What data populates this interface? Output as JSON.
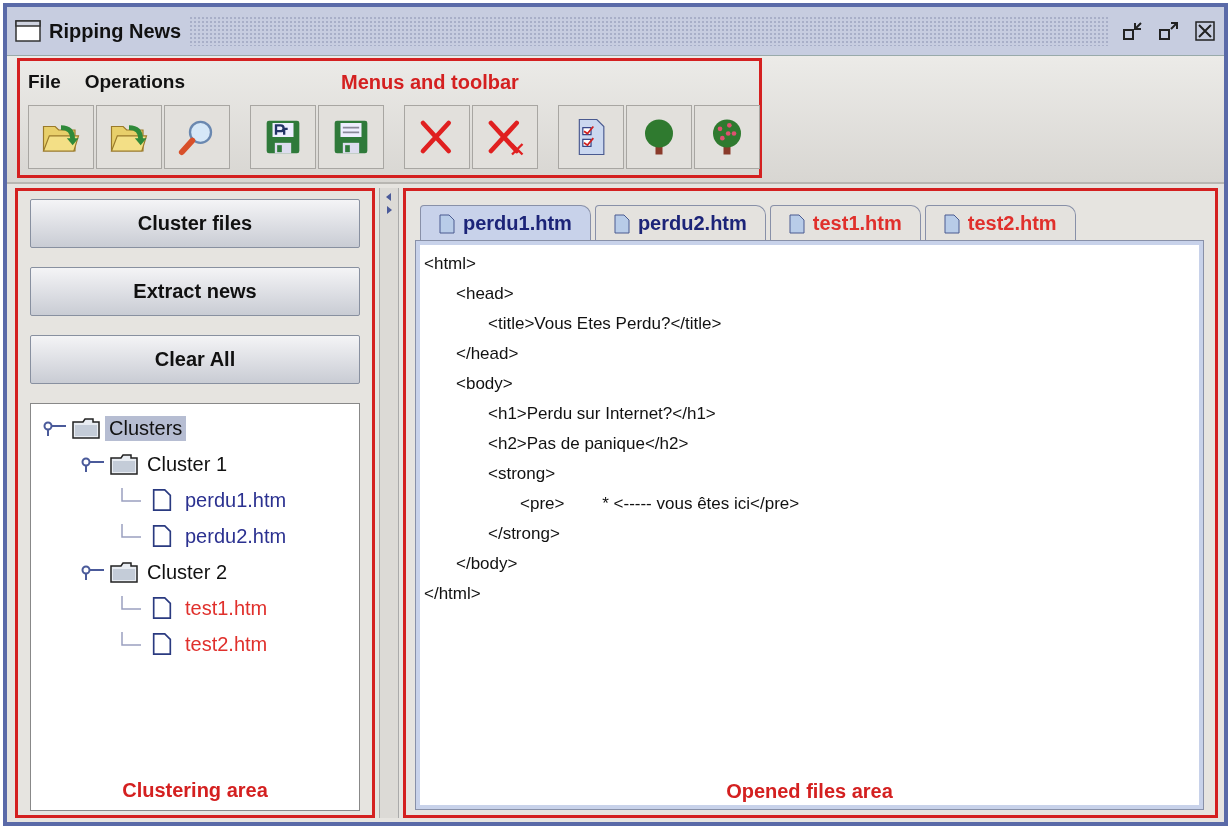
{
  "window": {
    "title": "Ripping News"
  },
  "menus": [
    {
      "label": "File"
    },
    {
      "label": "Operations"
    }
  ],
  "toolbar": {
    "groups": [
      [
        {
          "kind": "open-pr"
        },
        {
          "kind": "open"
        },
        {
          "kind": "search"
        }
      ],
      [
        {
          "kind": "save-pr"
        },
        {
          "kind": "save"
        }
      ],
      [
        {
          "kind": "delete"
        },
        {
          "kind": "delete-all"
        }
      ],
      [
        {
          "kind": "checklist"
        },
        {
          "kind": "tree"
        },
        {
          "kind": "fruit-tree"
        }
      ]
    ]
  },
  "annotations": {
    "toolbar": "Menus and toolbar",
    "left": "Clustering area",
    "right": "Opened files area"
  },
  "buttons": [
    {
      "label": "Cluster files"
    },
    {
      "label": "Extract news"
    },
    {
      "label": "Clear All"
    }
  ],
  "tree": [
    {
      "label": "Clusters",
      "selected": true,
      "expanded": true,
      "children": [
        {
          "label": "Cluster 1",
          "selected": false,
          "expanded": true,
          "children": [
            {
              "label": "perdu1.htm",
              "selected": false,
              "color": "#2b3190"
            },
            {
              "label": "perdu2.htm",
              "selected": false,
              "color": "#2b3190"
            }
          ]
        },
        {
          "label": "Cluster 2",
          "selected": false,
          "expanded": true,
          "children": [
            {
              "label": "test1.htm",
              "selected": false,
              "color": "#e0302c"
            },
            {
              "label": "test2.htm",
              "selected": false,
              "color": "#e0302c"
            }
          ]
        }
      ]
    }
  ],
  "tabs": [
    {
      "label": "perdu1.htm",
      "selected": true,
      "color": "#1c2478"
    },
    {
      "label": "perdu2.htm",
      "selected": false,
      "color": "#1c2478"
    },
    {
      "label": "test1.htm",
      "selected": false,
      "color": "#e0302c"
    },
    {
      "label": "test2.htm",
      "selected": false,
      "color": "#e0302c"
    }
  ],
  "code": [
    {
      "text": "<html>",
      "children": [
        {
          "text": "<head>",
          "children": [
            {
              "text": "<title>Vous Etes Perdu?</title>"
            }
          ]
        },
        {
          "text": "</head>"
        },
        {
          "text": "<body>",
          "children": [
            {
              "text": "<h1>Perdu sur Internet?</h1>"
            },
            {
              "text": "<h2>Pas de panique</h2>"
            },
            {
              "text": "<strong>",
              "children": [
                {
                  "text": "<pre>        * <----- vous êtes ici</pre>"
                }
              ]
            },
            {
              "text": "</strong>"
            }
          ]
        },
        {
          "text": "</body>"
        }
      ]
    },
    {
      "text": "</html>"
    }
  ]
}
